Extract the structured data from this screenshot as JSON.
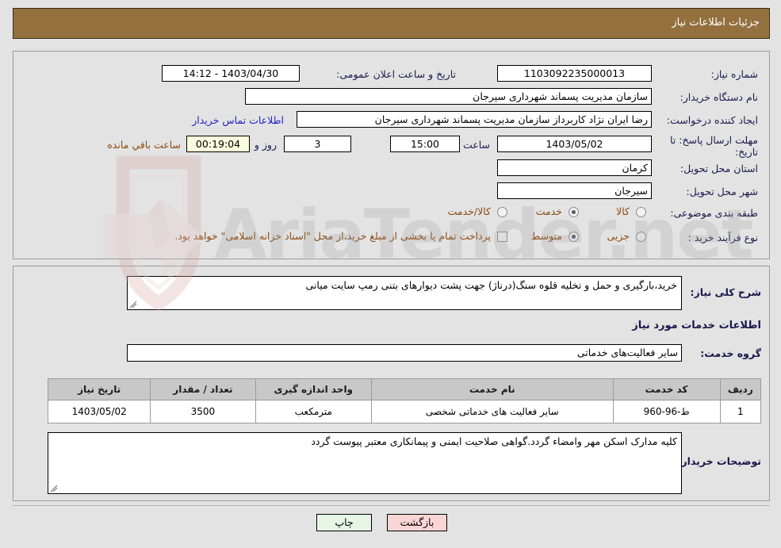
{
  "header": {
    "title": "جزئیات اطلاعات نیاز"
  },
  "top_section": {
    "need_number_label": "شماره نیاز:",
    "need_number_value": "1103092235000013",
    "announce_label": "تاریخ و ساعت اعلان عمومی:",
    "announce_value": "1403/04/30 - 14:12",
    "buyer_org_label": "نام دستگاه خریدار:",
    "buyer_org_value": "سازمان مدیریت پسماند شهرداری سیرجان",
    "requester_label": "ایجاد کننده درخواست:",
    "requester_value": "رضا ایران نژاد کاربرداز سازمان مدیریت پسماند شهرداری سیرجان",
    "contact_link": "اطلاعات تماس خریدار",
    "deadline_label": "مهلت ارسال پاسخ: تا تاریخ:",
    "deadline_date": "1403/05/02",
    "hour_label": "ساعت",
    "hour_value": "15:00",
    "days_value": "3",
    "days_unit": "روز و",
    "countdown_value": "00:19:04",
    "countdown_suffix": "ساعت باقي مانده",
    "province_label": "استان محل تحویل:",
    "province_value": "کرمان",
    "city_label": "شهر محل تحویل:",
    "city_value": "سیرجان",
    "category_label": "طبقه بندی موضوعی:",
    "category_options": [
      {
        "label": "کالا",
        "checked": false
      },
      {
        "label": "خدمت",
        "checked": true
      },
      {
        "label": "کالا/خدمت",
        "checked": false
      }
    ],
    "process_label": "نوع فرآیند خرید :",
    "process_options": [
      {
        "label": "جزیی",
        "checked": false
      },
      {
        "label": "متوسط",
        "checked": true
      }
    ],
    "treasury_checkbox_label": "پرداخت تمام یا بخشی از مبلغ خرید،از محل \"اسناد خزانه اسلامی\" خواهد بود.",
    "treasury_checked": false
  },
  "mid_section": {
    "description_label": "شرح کلی نیاز:",
    "description_value": "خرید،بارگیری و حمل و تخلیه قلوه سنگ(درناژ) جهت پشت دیوارهای بتنی رمپ سایت میانی",
    "services_heading": "اطلاعات خدمات مورد نیاز",
    "service_group_label": "گروه خدمت:",
    "service_group_value": "سایر فعالیت‌های خدماتی",
    "table": {
      "headers": [
        "ردیف",
        "کد خدمت",
        "نام خدمت",
        "واحد اندازه گیری",
        "تعداد / مقدار",
        "تاریخ نیاز"
      ],
      "rows": [
        [
          "1",
          "ط-96-960",
          "سایر فعالیت های خدماتی شخصی",
          "مترمکعب",
          "3500",
          "1403/05/02"
        ]
      ]
    },
    "buyer_notes_label": "توضیحات خریدار:",
    "buyer_notes_value": "کلیه مدارک اسکن مهر وامضاء گردد.گواهی صلاحیت ایمنی و پیمانکاری معتبر پیوست گردد"
  },
  "footer": {
    "print_label": "چاپ",
    "back_label": "بازگشت"
  },
  "colors": {
    "header_bg": "#94703f",
    "panel_bg": "#e3e3e3",
    "label": "#1b1b4f",
    "link": "#2222cc",
    "orange": "#8a4b12",
    "countdown_bg": "#fbfbdd",
    "table_header_bg": "#c8c8c8",
    "print_btn_bg": "#e6f5e6",
    "back_btn_bg": "#fad5d5"
  },
  "watermark": {
    "text": "AriaTender.net"
  }
}
